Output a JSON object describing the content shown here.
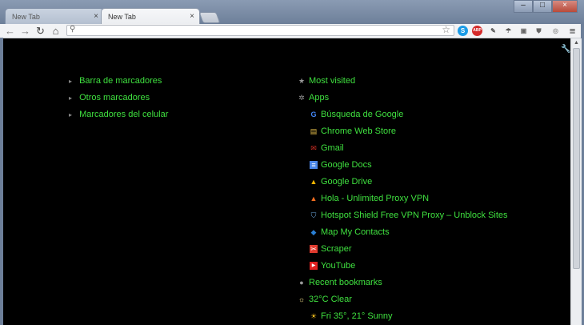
{
  "tabs": [
    {
      "label": "New Tab",
      "close": "×"
    },
    {
      "label": "New Tab",
      "close": "×"
    }
  ],
  "window_buttons": {
    "minimize": "–",
    "maximize": "□",
    "close": "×"
  },
  "toolbar": {
    "back": "←",
    "forward": "→",
    "reload": "↻",
    "home": "⌂",
    "omnibox_value": "",
    "search_icon": "search-icon",
    "star_icon": "star-icon",
    "extensions": [
      {
        "name": "skype",
        "glyph": "S",
        "color": "#1a9be6"
      },
      {
        "name": "adblock-plus",
        "glyph": "ABP",
        "color": "#d42a2a"
      },
      {
        "name": "extension-3",
        "glyph": "✎",
        "color": "#9aa0a8"
      },
      {
        "name": "extension-4",
        "glyph": "☂",
        "color": "#7a7f88"
      },
      {
        "name": "extension-5",
        "glyph": "▣",
        "color": "#8a9098"
      },
      {
        "name": "extension-6",
        "glyph": "⛊",
        "color": "#8a9098"
      },
      {
        "name": "extension-7",
        "glyph": "◎",
        "color": "#b0b4ba"
      }
    ],
    "menu": "≡"
  },
  "bookmarks": [
    {
      "label": "Barra de marcadores"
    },
    {
      "label": "Otros marcadores"
    },
    {
      "label": "Marcadores del celular"
    }
  ],
  "sections": {
    "most_visited": "Most visited",
    "apps": "Apps",
    "recent_bookmarks": "Recent bookmarks",
    "weather": "32°C Clear",
    "forecast": "Fri 35°, 21° Sunny"
  },
  "apps": [
    {
      "label": "Búsqueda de Google",
      "icon": "G",
      "color": "#4285f4"
    },
    {
      "label": "Chrome Web Store",
      "icon": "▤",
      "color": "#e8c04a"
    },
    {
      "label": "Gmail",
      "icon": "✉",
      "color": "#d93025"
    },
    {
      "label": "Google Docs",
      "icon": "≡",
      "color": "#4a86e8"
    },
    {
      "label": "Google Drive",
      "icon": "▲",
      "color": "#f4b400"
    },
    {
      "label": "Hola - Unlimited Proxy VPN",
      "icon": "🔥",
      "color": "#f06d20"
    },
    {
      "label": "Hotspot Shield Free VPN Proxy – Unblock Sites",
      "icon": "⛉",
      "color": "#6aa2d8"
    },
    {
      "label": "Map My Contacts",
      "icon": "◆",
      "color": "#2a7fd4"
    },
    {
      "label": "Scraper",
      "icon": "✂",
      "color": "#e03b2f"
    },
    {
      "label": "YouTube",
      "icon": "▶",
      "color": "#e02020"
    }
  ],
  "colors": {
    "link": "#3fe03f",
    "background": "#000000"
  }
}
